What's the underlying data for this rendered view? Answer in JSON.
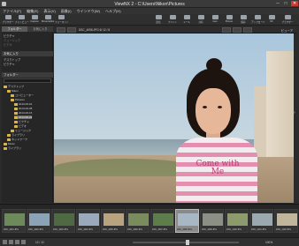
{
  "window": {
    "title": "ViewNX 2 - C:\\Users\\Nikon\\Pictures"
  },
  "menu": [
    "ファイル(F)",
    "編集(E)",
    "表示(V)",
    "画像(I)",
    "ウインドウ(W)",
    "ヘルプ(H)"
  ],
  "toolbar": {
    "left": [
      {
        "label": "ブラウザー"
      },
      {
        "label": "フォトビュー"
      },
      {
        "label": "Capture"
      },
      {
        "label": "Movie Editor"
      },
      {
        "label": "フォーマット"
      }
    ],
    "right": [
      {
        "label": "送信"
      },
      {
        "label": "プリント"
      },
      {
        "label": "メール"
      },
      {
        "label": "共有"
      },
      {
        "label": "Geo"
      },
      {
        "label": "Picture"
      },
      {
        "label": "保存"
      },
      {
        "label": "アップロード"
      },
      {
        "label": "NX"
      },
      {
        "label": "ブラウザー"
      }
    ]
  },
  "sidebar": {
    "tabs": [
      "フォルダー",
      "お気に入り"
    ],
    "shortcut_items": [
      "ピクチャ",
      "ミュージック",
      "ビデオ"
    ],
    "section_favorites": "お気に入り",
    "favorites": [
      "デスクトップ",
      "ピクチャ"
    ],
    "section_folders": "フォルダー",
    "tree": [
      "デスクトップ",
      "Nikon",
      "コンピューター",
      "Pictures",
      "2013-06-01",
      "2013-06-08",
      "2013-06-15",
      "2013-06-22",
      "ピクチャ",
      "ビデオ",
      "ミュージック",
      "ライブラリ",
      "ネットワーク",
      "Music",
      "ライブラリ"
    ]
  },
  "viewer": {
    "file_info": "DSC_4098.JPG  6/ 12 / 8",
    "right_label": "ビューア",
    "shirt_text": "Come with\nMe"
  },
  "filmstrip": {
    "thumbs": [
      {
        "caption": "DSC_4091.JPG",
        "color": "#6c8a5a"
      },
      {
        "caption": "DSC_4092.JPG",
        "color": "#8aa3b6"
      },
      {
        "caption": "DSC_4093.JPG",
        "color": "#4f6a43"
      },
      {
        "caption": "DSC_4094.JPG",
        "color": "#9aaabc"
      },
      {
        "caption": "DSC_4095.JPG",
        "color": "#b9a37f"
      },
      {
        "caption": "DSC_4096.JPG",
        "color": "#7a8c5e"
      },
      {
        "caption": "DSC_4097.JPG",
        "color": "#5d7d4a"
      },
      {
        "caption": "DSC_4098.JPG",
        "color": "#a7b8c4"
      },
      {
        "caption": "DSC_4099.JPG",
        "color": "#8b8f86"
      },
      {
        "caption": "DSC_4100.JPG",
        "color": "#8d9a6b"
      },
      {
        "caption": "DSC_4101.JPG",
        "color": "#9aa8b0"
      },
      {
        "caption": "DSC_4102.JPG",
        "color": "#c1b59b"
      }
    ],
    "selected_index": 7
  },
  "status": {
    "count_text": "12 / 12",
    "zoom_text": "100%"
  }
}
